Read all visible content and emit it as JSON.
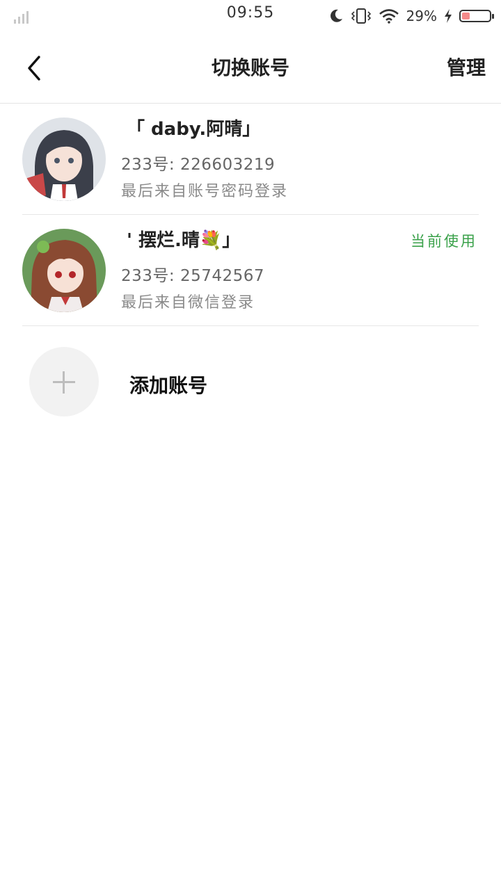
{
  "status_bar": {
    "time": "09:55",
    "battery_percent": "29%",
    "battery_level": 0.29,
    "icons": [
      "signal-icon",
      "moon-icon",
      "vibrate-icon",
      "wifi-icon",
      "charging-icon",
      "battery-icon"
    ]
  },
  "nav": {
    "title": "切换账号",
    "manage_label": "管理",
    "back_icon": "chevron-left-icon"
  },
  "accounts": [
    {
      "name": "「 daby.阿晴」",
      "id_text": "233号: 226603219",
      "login_method": "最后来自账号密码登录",
      "current": false
    },
    {
      "name": "' 摆烂.晴💐」",
      "id_text": "233号: 25742567",
      "login_method": "最后来自微信登录",
      "current": true,
      "current_label": "当前使用"
    }
  ],
  "add_account": {
    "label": "添加账号",
    "icon": "plus-icon"
  },
  "colors": {
    "accent_green": "#3aa14a",
    "divider": "#e6e6e6",
    "secondary_text": "#8a8a8a"
  }
}
